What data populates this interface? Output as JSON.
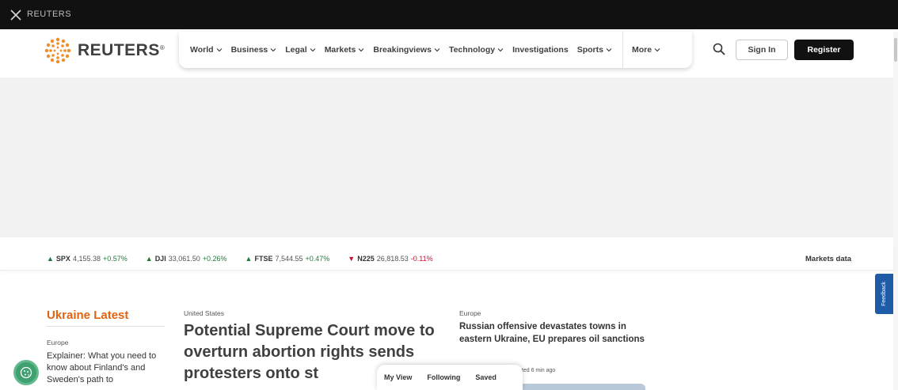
{
  "strip": {
    "label": "REUTERS"
  },
  "header": {
    "logo_text": "REUTERS",
    "logo_mark": "®",
    "nav": [
      "World",
      "Business",
      "Legal",
      "Markets",
      "Breakingviews",
      "Technology",
      "Investigations",
      "Sports",
      "More"
    ],
    "sign_in": "Sign In",
    "register": "Register"
  },
  "ticker": {
    "items": [
      {
        "symbol": "SPX",
        "value": "4,155.38",
        "change": "+0.57%",
        "direction": "up"
      },
      {
        "symbol": "DJI",
        "value": "33,061.50",
        "change": "+0.26%",
        "direction": "up"
      },
      {
        "symbol": "FTSE",
        "value": "7,544.55",
        "change": "+0.47%",
        "direction": "up"
      },
      {
        "symbol": "N225",
        "value": "26,818.53",
        "change": "-0.11%",
        "direction": "down"
      }
    ],
    "markets_link": "Markets data"
  },
  "feedback": "Feedback",
  "ukraine": {
    "heading": "Ukraine Latest",
    "kicker": "Europe",
    "story": "Explainer: What you need to know about Finland's and Sweden's path to"
  },
  "lead": {
    "kicker": "United States",
    "headline": "Potential Supreme Court move to overturn abortion rights sends protesters onto st"
  },
  "second": {
    "kicker": "Europe",
    "headline": "Russian offensive devastates towns in eastern Ukraine, EU prepares oil sanctions",
    "updated": "ated 6 min ago"
  },
  "my_bar": [
    "My View",
    "Following",
    "Saved"
  ],
  "colors": {
    "accent": "#e3620f",
    "up": "#1f7a3a",
    "down": "#c8102e",
    "feedback": "#1e5ca8",
    "cookie": "#3fa070"
  }
}
